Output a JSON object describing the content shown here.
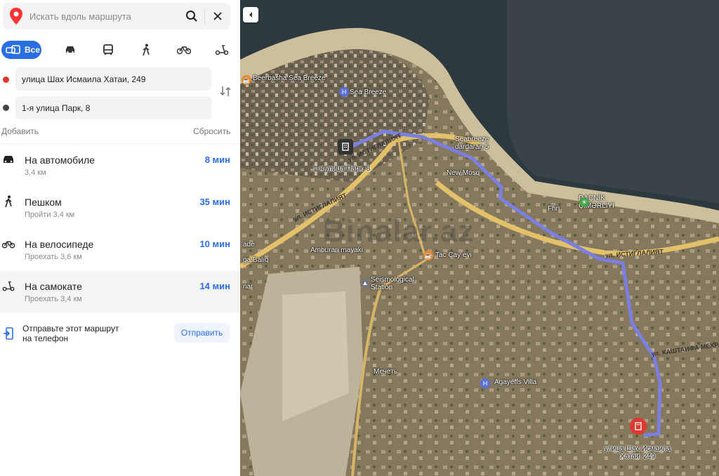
{
  "search": {
    "placeholder": "Искать вдоль маршрута"
  },
  "modes": {
    "all_label": "Все"
  },
  "route_points": {
    "from": "улица Шах Исмаила Хатаи, 249",
    "to": "1-я улица Парк, 8"
  },
  "actions": {
    "add": "Добавить",
    "reset": "Сбросить"
  },
  "routes": [
    {
      "title": "На автомобиле",
      "sub": "3,4 км",
      "time": "8 мин",
      "icon": "car-icon"
    },
    {
      "title": "Пешком",
      "sub": "Пройти 3,4 км",
      "time": "35 мин",
      "icon": "walk-icon"
    },
    {
      "title": "На велосипеде",
      "sub": "Проехать 3,6 км",
      "time": "10 мин",
      "icon": "bike-icon"
    },
    {
      "title": "На самокате",
      "sub": "Проехать 3,4 км",
      "time": "14 мин",
      "icon": "scooter-icon"
    }
  ],
  "send": {
    "text": "Отправьте этот маршрут на телефон",
    "button": "Отправить"
  },
  "map": {
    "labels": {
      "beerbasha": "Beerbasha Sea Breeze",
      "sea_breeze": "Sea Breeze",
      "seabreeze_dardaran": "Seabreeze dardaran 5",
      "new_mosque": "New Mosq",
      "dacnik": "DAÇNİK ÇİMƏRLİYİ",
      "fhn": "Fhn",
      "amburan": "Amburan mayaki",
      "tac_cay": "Tac Çay evi",
      "seismo": "Seismological Station",
      "mechet": "Мечеть",
      "agayeffs": "Agayeffs Villa",
      "destination": "улица Шах Исмаила Хатаи, 249",
      "origin": "1-я улица Парк, 8",
      "baliq": "ga Balıq",
      "ade": "ade",
      "nar": "nar",
      "istiglaliyat1": "ул. ИСТИГЛАЛИЯТ",
      "istiglaliyat2": "ул. ИСТИГЛАЛИЯТ",
      "istiglaliyat3": "ул. ИСТИГЛАЛИЯТ",
      "kashtaifa": "ул. КАШТАИФА МЕХРАЛИЕВА"
    },
    "watermark": "Binalar.az",
    "colors": {
      "route": "#7a7fe0",
      "accent": "#2a6ee4",
      "start_dot": "#e0382f",
      "end_dot": "#444444"
    }
  }
}
